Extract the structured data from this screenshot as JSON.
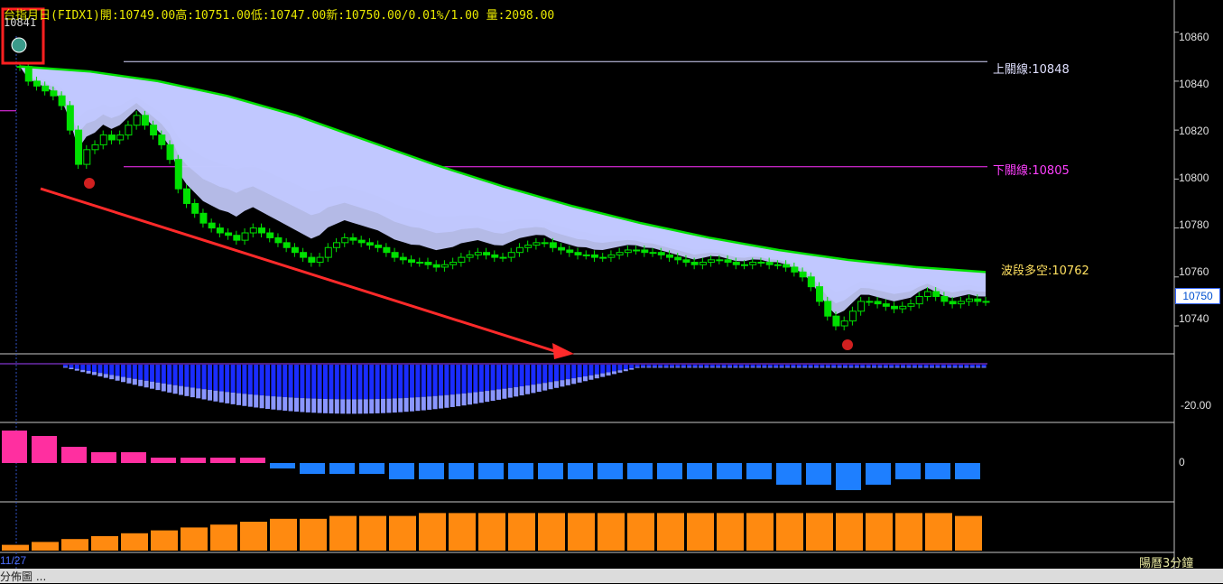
{
  "header": {
    "title": "台指月日(FIDX1)",
    "open_label": "開",
    "open": "10749.00",
    "high_label": "高",
    "high": "10751.00",
    "low_label": "低",
    "low": "10747.00",
    "last_label": "新",
    "last": "10750.00/0.01%/1.00",
    "vol_label": "量",
    "vol": "2098.00"
  },
  "first_value": "10841",
  "levels": {
    "upper_label": "上關線:10848",
    "upper": 10848,
    "lower_label": "下關線:10805",
    "lower": 10805,
    "wave_label": "波段多空:10762",
    "wave": 10762
  },
  "last_price_box": "10750",
  "axis": {
    "ticks": [
      "10860",
      "10840",
      "10820",
      "10800",
      "10780",
      "10760",
      "10740"
    ],
    "osc_tick": "-20.00",
    "hist_tick": "0"
  },
  "date_label": "11/27",
  "period_label": "陽曆3分鐘",
  "status_text": "分佈圖 ...",
  "colors": {
    "up": "#00e000",
    "down": "#00e000",
    "ma": "#00e000",
    "band": "#1a2cff",
    "arrow": "#ff2a2a",
    "hist_pos": "#ff2fa0",
    "hist_neg": "#1e7fff",
    "volume": "#ff8a10"
  },
  "chart_data": {
    "type": "candlestick",
    "ylim": [
      10733,
      10868
    ],
    "candles_close": [
      10846,
      10840,
      10838,
      10836,
      10834,
      10830,
      10820,
      10806,
      10812,
      10814,
      10818,
      10816,
      10818,
      10822,
      10826,
      10822,
      10818,
      10814,
      10808,
      10796,
      10790,
      10786,
      10782,
      10780,
      10778,
      10777,
      10775,
      10778,
      10780,
      10778,
      10776,
      10774,
      10772,
      10770,
      10768,
      10766,
      10768,
      10772,
      10774,
      10776,
      10775,
      10774,
      10773,
      10772,
      10770,
      10768,
      10767,
      10766,
      10766,
      10765,
      10764,
      10765,
      10766,
      10768,
      10769,
      10770,
      10769,
      10768,
      10768,
      10770,
      10772,
      10773,
      10774,
      10774,
      10772,
      10771,
      10770,
      10769,
      10769,
      10768,
      10768,
      10769,
      10770,
      10771,
      10771,
      10770,
      10770,
      10769,
      10768,
      10767,
      10766,
      10765,
      10766,
      10767,
      10767,
      10766,
      10765,
      10765,
      10766,
      10766,
      10765,
      10765,
      10764,
      10762,
      10760,
      10756,
      10750,
      10744,
      10740,
      10742,
      10746,
      10750,
      10750,
      10749,
      10748,
      10747,
      10748,
      10749,
      10752,
      10754,
      10752,
      10750,
      10749,
      10750,
      10751,
      10750,
      10750
    ],
    "ma_line": [
      10846,
      10844,
      10840,
      10834,
      10826,
      10816,
      10806,
      10797,
      10789,
      10782,
      10776,
      10771,
      10767,
      10764,
      10762
    ],
    "oscillator_min": -20,
    "histogram": [
      6,
      5,
      3,
      2,
      2,
      1,
      1,
      1,
      1,
      -1,
      -2,
      -2,
      -2,
      -3,
      -3,
      -3,
      -3,
      -3,
      -3,
      -3,
      -3,
      -3,
      -3,
      -3,
      -3,
      -3,
      -4,
      -4,
      -5,
      -4,
      -3,
      -3,
      -3
    ],
    "volume": [
      2,
      3,
      4,
      5,
      6,
      7,
      8,
      9,
      10,
      11,
      11,
      12,
      12,
      12,
      13,
      13,
      13,
      13,
      13,
      13,
      13,
      13,
      13,
      13,
      13,
      13,
      13,
      13,
      13,
      13,
      13,
      13,
      12
    ]
  }
}
